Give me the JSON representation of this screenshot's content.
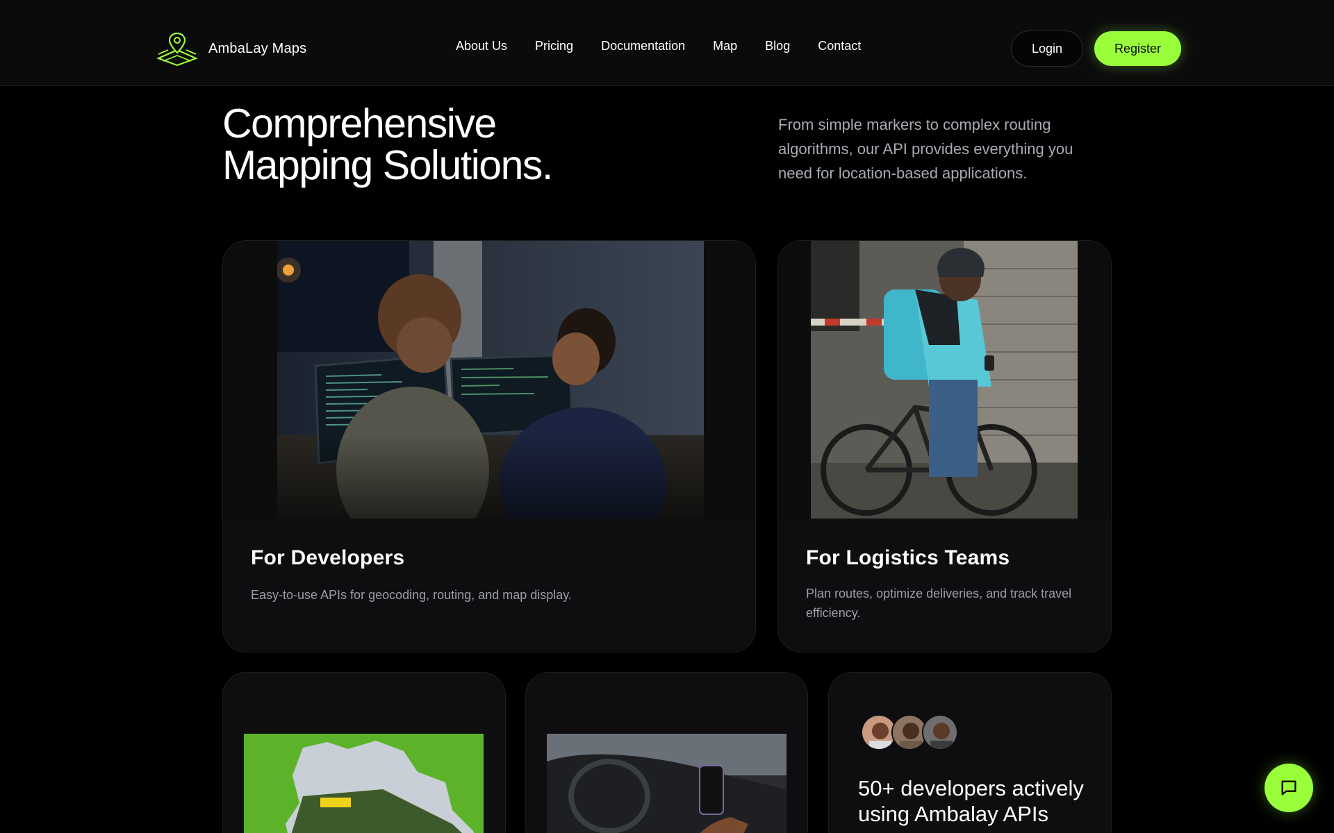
{
  "brand": {
    "name": "AmbaLay Maps",
    "logo_icon": "map-pin-logo-icon",
    "accent": "#9aff3b"
  },
  "nav": {
    "items": [
      {
        "label": "About Us"
      },
      {
        "label": "Pricing"
      },
      {
        "label": "Documentation"
      },
      {
        "label": "Map"
      },
      {
        "label": "Blog"
      },
      {
        "label": "Contact"
      }
    ]
  },
  "auth": {
    "login_label": "Login",
    "register_label": "Register"
  },
  "hero": {
    "title_line1": "Comprehensive",
    "title_line2": "Mapping Solutions.",
    "description": "From simple markers to complex routing algorithms, our API provides everything you need for location-based applications."
  },
  "cards": {
    "developers": {
      "title": "For Developers",
      "text": "Easy-to-use APIs for geocoding, routing, and map display.",
      "image_icon": "developers-at-screens-photo"
    },
    "logistics": {
      "title": "For Logistics Teams",
      "text": "Plan routes, optimize deliveries, and track travel efficiency.",
      "image_icon": "courier-with-bicycle-photo"
    },
    "taxi": {
      "image_icon": "taxi-map-photo"
    },
    "car": {
      "image_icon": "phone-in-car-photo"
    },
    "community": {
      "stat_text": "50+ developers actively using Ambalay APIs",
      "avatar_icons": [
        "avatar-1",
        "avatar-2",
        "avatar-3"
      ]
    }
  },
  "chat": {
    "icon": "chat-bubble-icon"
  }
}
